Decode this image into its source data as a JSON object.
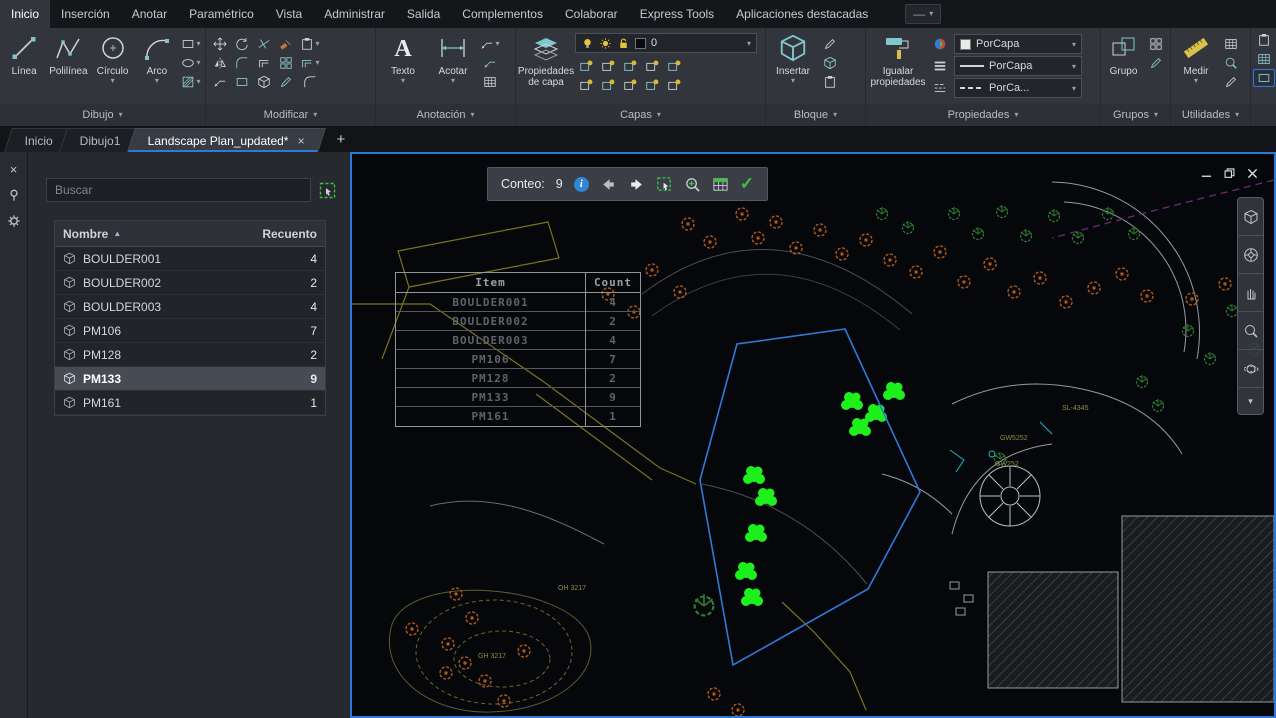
{
  "icons": {
    "chevron_down": "▾",
    "close": "×",
    "check": "✓",
    "sort_asc": "▲",
    "new_tab": "+",
    "info": "i",
    "menu_dash": "—"
  },
  "colors": {
    "accent_blue": "#2e7bd6",
    "viewport_border": "#2c79d8",
    "selection_green": "#1df01d",
    "plant_orange": "#a9561c",
    "check_green": "#3bc24a",
    "ribbon_bg": "#32353b",
    "canvas_bg": "#06070a"
  },
  "menubar": {
    "items": [
      "Inicio",
      "Inserción",
      "Anotar",
      "Paramétrico",
      "Vista",
      "Administrar",
      "Salida",
      "Complementos",
      "Colaborar",
      "Express Tools",
      "Aplicaciones destacadas"
    ]
  },
  "ribbon": {
    "panels": {
      "dibujo": {
        "label": "Dibujo",
        "linea": "Línea",
        "polilinea": "Polilínea",
        "circulo": "Círculo",
        "arco": "Arco"
      },
      "modificar": {
        "label": "Modificar"
      },
      "anotacion": {
        "label": "Anotación",
        "texto": "Texto",
        "acotar": "Acotar"
      },
      "capas": {
        "label": "Capas",
        "propiedades_capa": "Propiedades de capa",
        "layer_actual": "0"
      },
      "bloque": {
        "label": "Bloque",
        "insertar": "Insertar"
      },
      "propiedades": {
        "label": "Propiedades",
        "igualar": "Igualar propiedades",
        "color": "PorCapa",
        "grosor": "PorCapa",
        "tipo": "PorCa..."
      },
      "grupos": {
        "label": "Grupos",
        "grupo": "Grupo"
      },
      "utilidades": {
        "label": "Utilidades",
        "medir": "Medir"
      }
    }
  },
  "file_tabs": {
    "tabs": [
      "Inicio",
      "Dibujo1",
      "Landscape Plan_updated*"
    ]
  },
  "palette": {
    "search_placeholder": "Buscar",
    "columns": {
      "name": "Nombre",
      "count": "Recuento"
    },
    "selected": "PM133",
    "rows": [
      {
        "name": "BOULDER001",
        "count": "4"
      },
      {
        "name": "BOULDER002",
        "count": "2"
      },
      {
        "name": "BOULDER003",
        "count": "4"
      },
      {
        "name": "PM106",
        "count": "7"
      },
      {
        "name": "PM128",
        "count": "2"
      },
      {
        "name": "PM133",
        "count": "9"
      },
      {
        "name": "PM161",
        "count": "1"
      }
    ]
  },
  "count_toolbar": {
    "label": "Conteo:",
    "value": "9"
  },
  "cad_table": {
    "header": {
      "item": "Item",
      "count": "Count"
    },
    "rows": [
      {
        "item": "BOULDER001",
        "count": "4"
      },
      {
        "item": "BOULDER002",
        "count": "2"
      },
      {
        "item": "BOULDER003",
        "count": "4"
      },
      {
        "item": "PM106",
        "count": "7"
      },
      {
        "item": "PM128",
        "count": "2"
      },
      {
        "item": "PM133",
        "count": "9"
      },
      {
        "item": "PM161",
        "count": "1"
      }
    ]
  },
  "drawing": {
    "labels": [
      "GW5252",
      "SL-4345",
      "GW252",
      "OH 3217",
      "GH 3217"
    ]
  }
}
